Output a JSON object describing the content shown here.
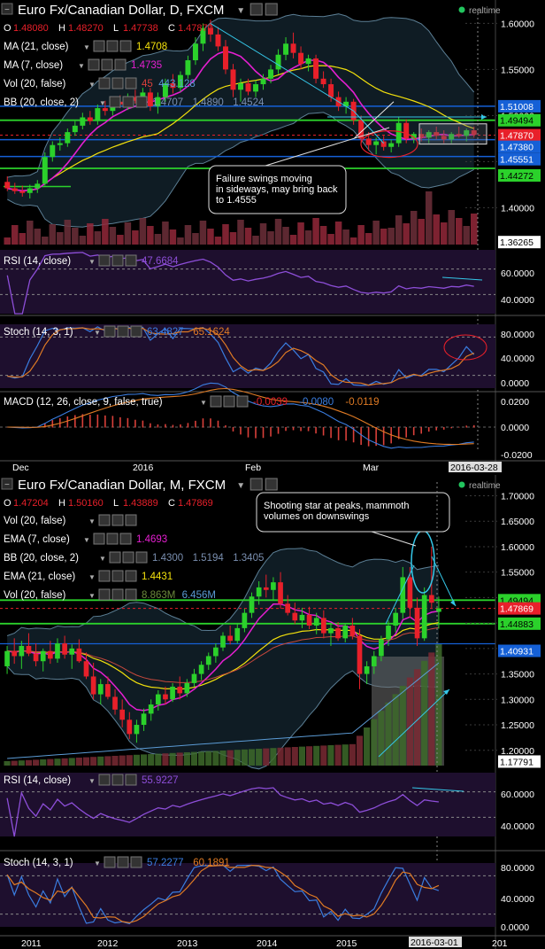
{
  "top": {
    "title": "Euro Fx/Canadian Dollar, D, FXCM",
    "realtime": "realtime",
    "ohlc": [
      {
        "k": "O",
        "v": "1.48080"
      },
      {
        "k": "H",
        "v": "1.48270"
      },
      {
        "k": "L",
        "v": "1.47738"
      },
      {
        "k": "C",
        "v": "1.47870"
      }
    ],
    "indicators": [
      {
        "label": "MA (21, close)",
        "values": [
          "1.4708"
        ],
        "colors": [
          "#f3e10c"
        ]
      },
      {
        "label": "MA (7, close)",
        "values": [
          "1.4735"
        ],
        "colors": [
          "#e51fd1"
        ]
      },
      {
        "label": "Vol (20, false)",
        "values": [
          "45",
          "443.128"
        ],
        "colors": [
          "#d9403a",
          "#5b9bd5"
        ]
      },
      {
        "label": "BB (20, close, 2)",
        "values": [
          "1.4707",
          "1.4890",
          "1.4524"
        ],
        "colors": [
          "#7a8fb0",
          "#7a8fb0",
          "#7a8fb0"
        ]
      }
    ],
    "price_axis": [
      "1.60000",
      "1.55000",
      "1.50000",
      "1.45000",
      "1.40000"
    ],
    "price_tags": [
      {
        "text": "1.51008",
        "bg": "#1560d6",
        "fg": "#fff"
      },
      {
        "text": "1.49494",
        "bg": "#2bd12b",
        "fg": "#000"
      },
      {
        "text": "1.47870",
        "bg": "#e8202a",
        "fg": "#fff"
      },
      {
        "text": "1.47380",
        "bg": "#1560d6",
        "fg": "#fff"
      },
      {
        "text": "1.45551",
        "bg": "#1560d6",
        "fg": "#fff"
      },
      {
        "text": "1.44272",
        "bg": "#2bd12b",
        "fg": "#000"
      },
      {
        "text": "1.36265",
        "bg": "#ffffff",
        "fg": "#000"
      }
    ],
    "annotation": "Failure swings moving in sideways, may bring back to 1.4555",
    "rsi": {
      "label": "RSI (14, close)",
      "value": "47.6684",
      "axis": [
        "60.0000",
        "40.0000"
      ]
    },
    "stoch": {
      "label": "Stoch (14, 3, 1)",
      "values": [
        "63.4827",
        "65.1624"
      ],
      "axis": [
        "80.0000",
        "40.0000",
        "0.0000"
      ]
    },
    "macd": {
      "label": "MACD (12, 26, close, 9, false, true)",
      "values": [
        "-0.0039",
        "-0.0080",
        "-0.0119"
      ],
      "axis": [
        "0.0200",
        "0.0000",
        "-0.0200"
      ]
    },
    "time_axis": [
      "Dec",
      "2016",
      "Feb",
      "Mar"
    ],
    "time_tag": "2016-03-28"
  },
  "bottom": {
    "title": "Euro Fx/Canadian Dollar, M, FXCM",
    "realtime": "realtime",
    "ohlc": [
      {
        "k": "O",
        "v": "1.47204"
      },
      {
        "k": "H",
        "v": "1.50160"
      },
      {
        "k": "L",
        "v": "1.43889"
      },
      {
        "k": "C",
        "v": "1.47869"
      }
    ],
    "indicators": [
      {
        "label": "Vol (20, false)",
        "values": [],
        "colors": []
      },
      {
        "label": "EMA (7, close)",
        "values": [
          "1.4693"
        ],
        "colors": [
          "#e51fd1"
        ]
      },
      {
        "label": "BB (20, close, 2)",
        "values": [
          "1.4300",
          "1.5194",
          "1.3405"
        ],
        "colors": [
          "#7a8fb0",
          "#7a8fb0",
          "#7a8fb0"
        ]
      },
      {
        "label": "EMA (21, close)",
        "values": [
          "1.4431"
        ],
        "colors": [
          "#f3e10c"
        ]
      },
      {
        "label": "Vol (20, false)",
        "values": [
          "8.863M",
          "6.456M"
        ],
        "colors": [
          "#6c8a3c",
          "#5b9bd5"
        ]
      }
    ],
    "price_axis": [
      "1.70000",
      "1.65000",
      "1.60000",
      "1.55000",
      "1.50000",
      "1.45000",
      "1.40000",
      "1.35000",
      "1.30000",
      "1.25000",
      "1.20000"
    ],
    "price_tags": [
      {
        "text": "1.49494",
        "bg": "#2bd12b",
        "fg": "#000"
      },
      {
        "text": "1.47869",
        "bg": "#e8202a",
        "fg": "#fff"
      },
      {
        "text": "1.44883",
        "bg": "#2bd12b",
        "fg": "#000"
      },
      {
        "text": "1.40931",
        "bg": "#1560d6",
        "fg": "#fff"
      },
      {
        "text": "1.17791",
        "bg": "#ffffff",
        "fg": "#000"
      }
    ],
    "annotation": "Shooting star at peaks, mammoth volumes on downswings",
    "rsi": {
      "label": "RSI (14, close)",
      "value": "55.9227",
      "axis": [
        "60.0000",
        "40.0000"
      ]
    },
    "stoch": {
      "label": "Stoch (14, 3, 1)",
      "values": [
        "57.2277",
        "60.1891"
      ],
      "axis": [
        "80.0000",
        "40.0000",
        "0.0000"
      ]
    },
    "time_axis": [
      "2011",
      "2012",
      "2013",
      "2014",
      "2015",
      "201"
    ],
    "time_tag": "2016-03-01"
  },
  "chart_data": [
    {
      "type": "candlestick",
      "title": "Euro Fx/Canadian Dollar, D, FXCM",
      "x_ticks": [
        "Dec",
        "2016",
        "Feb",
        "Mar"
      ],
      "ylim": [
        1.36,
        1.61
      ],
      "candles": [
        [
          1.428,
          1.434,
          1.418,
          1.421
        ],
        [
          1.421,
          1.427,
          1.415,
          1.418
        ],
        [
          1.418,
          1.424,
          1.412,
          1.416
        ],
        [
          1.416,
          1.425,
          1.41,
          1.421
        ],
        [
          1.421,
          1.43,
          1.416,
          1.426
        ],
        [
          1.426,
          1.46,
          1.424,
          1.455
        ],
        [
          1.455,
          1.472,
          1.45,
          1.468
        ],
        [
          1.468,
          1.476,
          1.462,
          1.47
        ],
        [
          1.47,
          1.486,
          1.466,
          1.482
        ],
        [
          1.482,
          1.494,
          1.478,
          1.489
        ],
        [
          1.489,
          1.503,
          1.485,
          1.498
        ],
        [
          1.498,
          1.505,
          1.49,
          1.494
        ],
        [
          1.494,
          1.512,
          1.49,
          1.508
        ],
        [
          1.508,
          1.516,
          1.5,
          1.505
        ],
        [
          1.505,
          1.52,
          1.5,
          1.515
        ],
        [
          1.515,
          1.522,
          1.508,
          1.512
        ],
        [
          1.512,
          1.524,
          1.506,
          1.52
        ],
        [
          1.52,
          1.528,
          1.513,
          1.516
        ],
        [
          1.516,
          1.53,
          1.51,
          1.525
        ],
        [
          1.525,
          1.53,
          1.505,
          1.51
        ],
        [
          1.51,
          1.525,
          1.502,
          1.52
        ],
        [
          1.52,
          1.54,
          1.515,
          1.535
        ],
        [
          1.535,
          1.545,
          1.524,
          1.53
        ],
        [
          1.53,
          1.548,
          1.526,
          1.544
        ],
        [
          1.544,
          1.565,
          1.54,
          1.56
        ],
        [
          1.56,
          1.585,
          1.555,
          1.578
        ],
        [
          1.578,
          1.6,
          1.57,
          1.595
        ],
        [
          1.595,
          1.604,
          1.58,
          1.588
        ],
        [
          1.588,
          1.596,
          1.57,
          1.575
        ],
        [
          1.575,
          1.582,
          1.545,
          1.55
        ],
        [
          1.55,
          1.556,
          1.52,
          1.528
        ],
        [
          1.528,
          1.54,
          1.515,
          1.535
        ],
        [
          1.535,
          1.54,
          1.522,
          1.526
        ],
        [
          1.526,
          1.538,
          1.52,
          1.534
        ],
        [
          1.534,
          1.545,
          1.528,
          1.54
        ],
        [
          1.54,
          1.555,
          1.535,
          1.55
        ],
        [
          1.55,
          1.572,
          1.545,
          1.566
        ],
        [
          1.566,
          1.585,
          1.56,
          1.578
        ],
        [
          1.578,
          1.59,
          1.562,
          1.568
        ],
        [
          1.568,
          1.575,
          1.55,
          1.556
        ],
        [
          1.556,
          1.566,
          1.548,
          1.562
        ],
        [
          1.562,
          1.566,
          1.535,
          1.54
        ],
        [
          1.54,
          1.548,
          1.53,
          1.534
        ],
        [
          1.534,
          1.54,
          1.515,
          1.52
        ],
        [
          1.52,
          1.526,
          1.505,
          1.51
        ],
        [
          1.51,
          1.52,
          1.502,
          1.515
        ],
        [
          1.515,
          1.518,
          1.49,
          1.495
        ],
        [
          1.495,
          1.5,
          1.47,
          1.475
        ],
        [
          1.475,
          1.482,
          1.462,
          1.468
        ],
        [
          1.468,
          1.476,
          1.458,
          1.472
        ],
        [
          1.472,
          1.478,
          1.462,
          1.466
        ],
        [
          1.466,
          1.474,
          1.46,
          1.47
        ],
        [
          1.47,
          1.498,
          1.466,
          1.492
        ],
        [
          1.492,
          1.496,
          1.47,
          1.475
        ],
        [
          1.475,
          1.482,
          1.47,
          1.48
        ],
        [
          1.48,
          1.486,
          1.472,
          1.476
        ],
        [
          1.476,
          1.484,
          1.47,
          1.482
        ],
        [
          1.482,
          1.488,
          1.474,
          1.478
        ],
        [
          1.478,
          1.484,
          1.47,
          1.474
        ],
        [
          1.474,
          1.482,
          1.47,
          1.48
        ],
        [
          1.48,
          1.488,
          1.476,
          1.478
        ],
        [
          1.478,
          1.486,
          1.472,
          1.484
        ],
        [
          1.484,
          1.488,
          1.476,
          1.479
        ]
      ]
    },
    {
      "type": "candlestick",
      "title": "Euro Fx/Canadian Dollar, M, FXCM",
      "x_ticks": [
        "2011",
        "2012",
        "2013",
        "2014",
        "2015",
        "201"
      ],
      "ylim": [
        1.17,
        1.72
      ],
      "candles": [
        [
          1.365,
          1.405,
          1.35,
          1.395
        ],
        [
          1.395,
          1.42,
          1.37,
          1.385
        ],
        [
          1.385,
          1.415,
          1.36,
          1.405
        ],
        [
          1.405,
          1.43,
          1.385,
          1.39
        ],
        [
          1.39,
          1.41,
          1.365,
          1.375
        ],
        [
          1.375,
          1.4,
          1.355,
          1.395
        ],
        [
          1.395,
          1.415,
          1.37,
          1.38
        ],
        [
          1.38,
          1.42,
          1.372,
          1.41
        ],
        [
          1.41,
          1.425,
          1.38,
          1.388
        ],
        [
          1.388,
          1.408,
          1.36,
          1.4
        ],
        [
          1.4,
          1.418,
          1.372,
          1.375
        ],
        [
          1.375,
          1.392,
          1.34,
          1.345
        ],
        [
          1.345,
          1.372,
          1.3,
          1.31
        ],
        [
          1.31,
          1.34,
          1.29,
          1.33
        ],
        [
          1.33,
          1.345,
          1.3,
          1.305
        ],
        [
          1.305,
          1.32,
          1.27,
          1.28
        ],
        [
          1.28,
          1.3,
          1.245,
          1.26
        ],
        [
          1.26,
          1.275,
          1.222,
          1.232
        ],
        [
          1.232,
          1.26,
          1.215,
          1.25
        ],
        [
          1.25,
          1.282,
          1.238,
          1.272
        ],
        [
          1.272,
          1.3,
          1.258,
          1.29
        ],
        [
          1.29,
          1.318,
          1.278,
          1.31
        ],
        [
          1.31,
          1.325,
          1.29,
          1.3
        ],
        [
          1.3,
          1.332,
          1.295,
          1.325
        ],
        [
          1.325,
          1.345,
          1.3,
          1.312
        ],
        [
          1.312,
          1.34,
          1.305,
          1.332
        ],
        [
          1.332,
          1.36,
          1.325,
          1.35
        ],
        [
          1.35,
          1.375,
          1.338,
          1.368
        ],
        [
          1.368,
          1.392,
          1.358,
          1.385
        ],
        [
          1.385,
          1.41,
          1.372,
          1.402
        ],
        [
          1.402,
          1.432,
          1.395,
          1.425
        ],
        [
          1.425,
          1.445,
          1.408,
          1.415
        ],
        [
          1.415,
          1.448,
          1.41,
          1.44
        ],
        [
          1.44,
          1.478,
          1.432,
          1.47
        ],
        [
          1.47,
          1.51,
          1.46,
          1.502
        ],
        [
          1.502,
          1.532,
          1.486,
          1.52
        ],
        [
          1.52,
          1.545,
          1.5,
          1.515
        ],
        [
          1.515,
          1.54,
          1.495,
          1.53
        ],
        [
          1.53,
          1.55,
          1.478,
          1.488
        ],
        [
          1.488,
          1.505,
          1.465,
          1.47
        ],
        [
          1.47,
          1.49,
          1.448,
          1.455
        ],
        [
          1.455,
          1.48,
          1.44,
          1.466
        ],
        [
          1.466,
          1.482,
          1.438,
          1.445
        ],
        [
          1.445,
          1.47,
          1.428,
          1.46
        ],
        [
          1.46,
          1.475,
          1.42,
          1.43
        ],
        [
          1.43,
          1.448,
          1.405,
          1.44
        ],
        [
          1.44,
          1.452,
          1.415,
          1.42
        ],
        [
          1.42,
          1.45,
          1.412,
          1.445
        ],
        [
          1.445,
          1.46,
          1.418,
          1.425
        ],
        [
          1.425,
          1.438,
          1.32,
          1.35
        ],
        [
          1.35,
          1.375,
          1.33,
          1.365
        ],
        [
          1.365,
          1.395,
          1.35,
          1.385
        ],
        [
          1.385,
          1.425,
          1.375,
          1.418
        ],
        [
          1.418,
          1.455,
          1.405,
          1.445
        ],
        [
          1.445,
          1.48,
          1.432,
          1.47
        ],
        [
          1.47,
          1.56,
          1.458,
          1.54
        ],
        [
          1.54,
          1.56,
          1.46,
          1.48
        ],
        [
          1.48,
          1.5,
          1.405,
          1.42
        ],
        [
          1.42,
          1.52,
          1.415,
          1.505
        ],
        [
          1.505,
          1.6,
          1.48,
          1.49
        ],
        [
          1.472,
          1.502,
          1.439,
          1.479
        ]
      ]
    }
  ]
}
